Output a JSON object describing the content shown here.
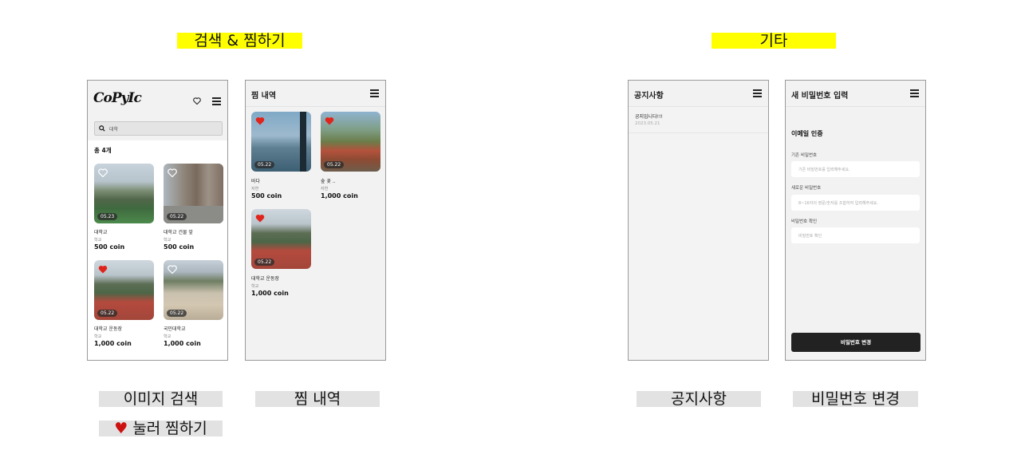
{
  "sections": {
    "search_title": "검색 & 찜하기",
    "other_title": "기타"
  },
  "captions": {
    "image_search": "이미지 검색",
    "wishlist": "찜 내역",
    "tap_to_wish_heart": "♥",
    "tap_to_wish": "눌러 찜하기",
    "notice": "공지사항",
    "change_password": "비밀번호 변경"
  },
  "colors": {
    "highlight_yellow": "#ffff00",
    "highlight_gray": "#e2e2e2",
    "heart_red": "#e0241b",
    "button_dark": "#222222"
  },
  "search_screen": {
    "logo": "CoPyIc",
    "search_value": "대학",
    "total": "총 4개",
    "items": [
      {
        "name": "대학교",
        "category": "학교",
        "price": "500 coin",
        "date": "05.23",
        "liked": false,
        "image": "campus-field"
      },
      {
        "name": "대학교 건물 앞",
        "category": "학교",
        "price": "500 coin",
        "date": "05.22",
        "liked": false,
        "image": "building"
      },
      {
        "name": "대학교 운동장",
        "category": "학교",
        "price": "1,000 coin",
        "date": "05.22",
        "liked": true,
        "image": "track"
      },
      {
        "name": "국민대학교",
        "category": "학교",
        "price": "1,000 coin",
        "date": "05.22",
        "liked": false,
        "image": "plaza"
      }
    ]
  },
  "wishlist_screen": {
    "title": "찜 내역",
    "items": [
      {
        "name": "바다",
        "category": "자연",
        "price": "500 coin",
        "date": "05.22",
        "image": "sea"
      },
      {
        "name": "숲 꽃 ..",
        "category": "자연",
        "price": "1,000 coin",
        "date": "05.22",
        "image": "flowers"
      },
      {
        "name": "대학교 운동장",
        "category": "학교",
        "price": "1,000 coin",
        "date": "05.22",
        "image": "track"
      }
    ]
  },
  "notice_screen": {
    "title": "공지사항",
    "items": [
      {
        "title": "공지입니다!!!",
        "date": "2023.05.21"
      }
    ]
  },
  "password_screen": {
    "title": "새 비밀번호 입력",
    "section": "이메일 인증",
    "current_label": "기존 비밀번호",
    "current_placeholder": "기존 비밀번호를 입력해주세요.",
    "new_label": "새로운 비밀번호",
    "new_placeholder": "8~16자의 영문/숫자를 조합하여 입력해주세요.",
    "confirm_label": "비밀번호 확인",
    "confirm_placeholder": "비밀번호 확인",
    "submit": "비밀번호 변경"
  }
}
